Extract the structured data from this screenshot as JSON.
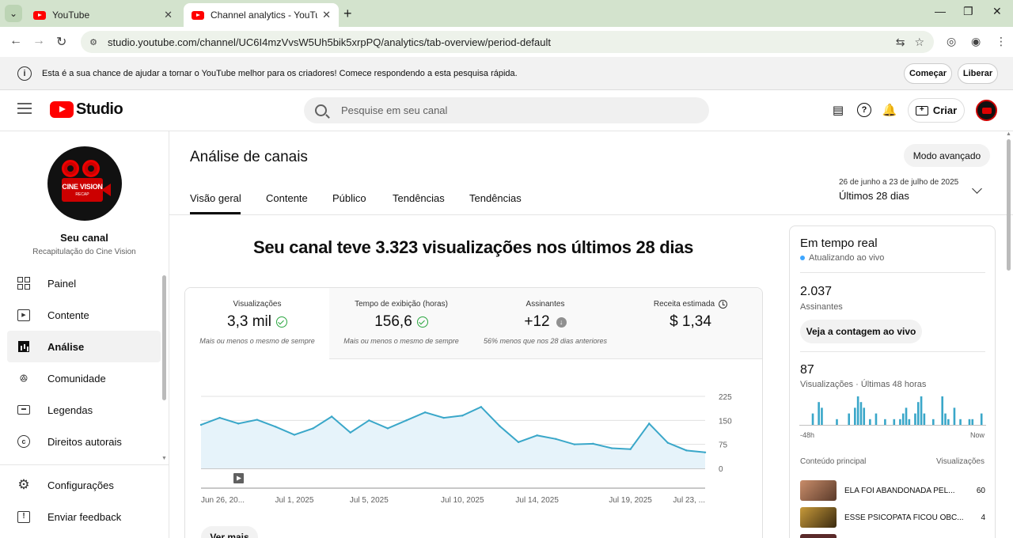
{
  "browser": {
    "tabs": [
      {
        "title": "YouTube"
      },
      {
        "title": "Channel analytics - YouTube Stu"
      }
    ],
    "url": "studio.youtube.com/channel/UC6I4mzVvsW5Uh5bik5xrpPQ/analytics/tab-overview/period-default"
  },
  "survey": {
    "text": "Esta é a sua chance de ajudar a tornar o YouTube melhor para os criadores! Comece respondendo a esta pesquisa rápida.",
    "start_label": "Começar",
    "dismiss_label": "Liberar"
  },
  "header": {
    "logo_text": "Studio",
    "search_placeholder": "Pesquise em seu canal",
    "create_label": "Criar"
  },
  "sidebar": {
    "channel_logo_text": "CINE VISION",
    "channel_logo_sub": "RECAP",
    "channel_title": "Seu canal",
    "channel_subtitle": "Recapitulação do Cine Vision",
    "items": [
      {
        "label": "Painel",
        "icon": "dashboard-icon"
      },
      {
        "label": "Contente",
        "icon": "content-icon"
      },
      {
        "label": "Análise",
        "icon": "analytics-icon"
      },
      {
        "label": "Comunidade",
        "icon": "community-icon"
      },
      {
        "label": "Legendas",
        "icon": "subtitles-icon"
      },
      {
        "label": "Direitos autorais",
        "icon": "copyright-icon"
      }
    ],
    "bottom_items": [
      {
        "label": "Configurações",
        "icon": "settings-icon"
      },
      {
        "label": "Enviar feedback",
        "icon": "feedback-icon"
      }
    ]
  },
  "main": {
    "title": "Análise de canais",
    "advanced_label": "Modo avançado",
    "tabs": [
      {
        "label": "Visão geral"
      },
      {
        "label": "Contente"
      },
      {
        "label": "Público"
      },
      {
        "label": "Tendências"
      },
      {
        "label": "Tendências"
      }
    ],
    "period_range": "26 de junho a 23 de julho de 2025",
    "period_label": "Últimos 28 dias",
    "headline": "Seu canal teve 3.323 visualizações nos últimos 28 dias",
    "metrics": [
      {
        "label": "Visualizações",
        "value": "3,3 mil",
        "note": "Mais ou menos o mesmo de sempre"
      },
      {
        "label": "Tempo de exibição (horas)",
        "value": "156,6",
        "note": "Mais ou menos o mesmo de sempre"
      },
      {
        "label": "Assinantes",
        "value": "+12",
        "note": "56% menos que nos 28 dias anteriores"
      },
      {
        "label": "Receita estimada",
        "value": "$ 1,34",
        "note": ""
      }
    ],
    "see_more_label": "Ver mais"
  },
  "chart_data": {
    "type": "area",
    "x": [
      "Jun 26, 20...",
      "",
      "",
      "",
      "",
      "Jul 1, 2025",
      "",
      "",
      "",
      "Jul 5, 2025",
      "",
      "",
      "",
      "",
      "Jul 10, 2025",
      "",
      "",
      "",
      "Jul 14, 2025",
      "",
      "",
      "",
      "",
      "Jul 19, 2025",
      "",
      "",
      "",
      "Jul 23, ..."
    ],
    "xticks": [
      "Jun 26, 20...",
      "Jul 1, 2025",
      "Jul 5, 2025",
      "Jul 10, 2025",
      "Jul 14, 2025",
      "Jul 19, 2025",
      "Jul 23, ..."
    ],
    "values": [
      136,
      158,
      140,
      152,
      130,
      105,
      125,
      162,
      112,
      150,
      125,
      150,
      175,
      158,
      165,
      192,
      132,
      82,
      103,
      92,
      75,
      77,
      63,
      60,
      140,
      80,
      56,
      50
    ],
    "ylim": [
      0,
      225
    ],
    "yticks": [
      0,
      75,
      150,
      225
    ],
    "grid": true
  },
  "realtime": {
    "title": "Em tempo real",
    "live_text": "Atualizando ao vivo",
    "subs_value": "2.037",
    "subs_label": "Assinantes",
    "live_count_label": "Veja a contagem ao vivo",
    "views_value": "87",
    "views_label": "Visualizações · Últimas 48 horas",
    "axis_start": "-48h",
    "axis_end": "Now",
    "bars": [
      0,
      0,
      0,
      0,
      2,
      0,
      4,
      3,
      0,
      0,
      0,
      0,
      1,
      0,
      0,
      0,
      2,
      0,
      3,
      5,
      4,
      3,
      0,
      1,
      0,
      2,
      0,
      0,
      1,
      0,
      0,
      1,
      0,
      1,
      2,
      3,
      1,
      0,
      2,
      4,
      5,
      2,
      0,
      0,
      1,
      0,
      0,
      5,
      2,
      1,
      0,
      3,
      0,
      1,
      0,
      0,
      1,
      1,
      0,
      0,
      2,
      0
    ],
    "bars_note": "Relative bar heights in the 48h sparkline (unlabeled).",
    "content_header": "Conteúdo principal",
    "views_header": "Visualizações",
    "top_content": [
      {
        "title": "ELA FOI ABANDONADA PEL...",
        "views": "60",
        "thumb_color": "#a56b4a"
      },
      {
        "title": "ESSE PSICOPATA FICOU OBC...",
        "views": "4",
        "thumb_color": "#7a5a24"
      }
    ]
  }
}
